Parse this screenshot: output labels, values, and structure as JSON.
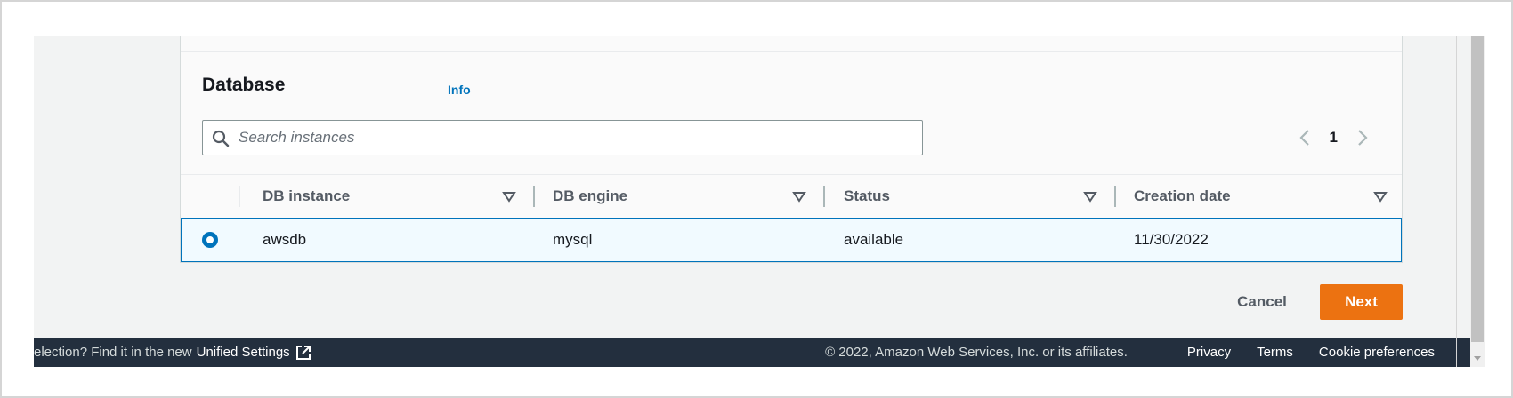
{
  "panel": {
    "title": "Database",
    "info_link": "Info"
  },
  "search": {
    "placeholder": "Search instances",
    "value": ""
  },
  "pagination": {
    "current_page": "1"
  },
  "table": {
    "columns": [
      "DB instance",
      "DB engine",
      "Status",
      "Creation date"
    ],
    "rows": [
      {
        "selected": true,
        "cells": [
          "awsdb",
          "mysql",
          "available",
          "11/30/2022"
        ]
      }
    ]
  },
  "actions": {
    "cancel_label": "Cancel",
    "next_label": "Next"
  },
  "footer": {
    "settings_notice": "election? Find it in the new",
    "settings_link": "Unified Settings",
    "copyright": "© 2022, Amazon Web Services, Inc. or its affiliates.",
    "links": [
      "Privacy",
      "Terms",
      "Cookie preferences"
    ]
  },
  "colors": {
    "accent": "#0073bb",
    "primary_button": "#ec7211",
    "footer_bg": "#232f3e",
    "page_bg": "#f2f3f3"
  },
  "icons": {
    "search": "search-icon",
    "prev": "chevron-left-icon",
    "next": "chevron-right-icon",
    "sort": "sort-down-icon",
    "external": "external-link-icon"
  }
}
